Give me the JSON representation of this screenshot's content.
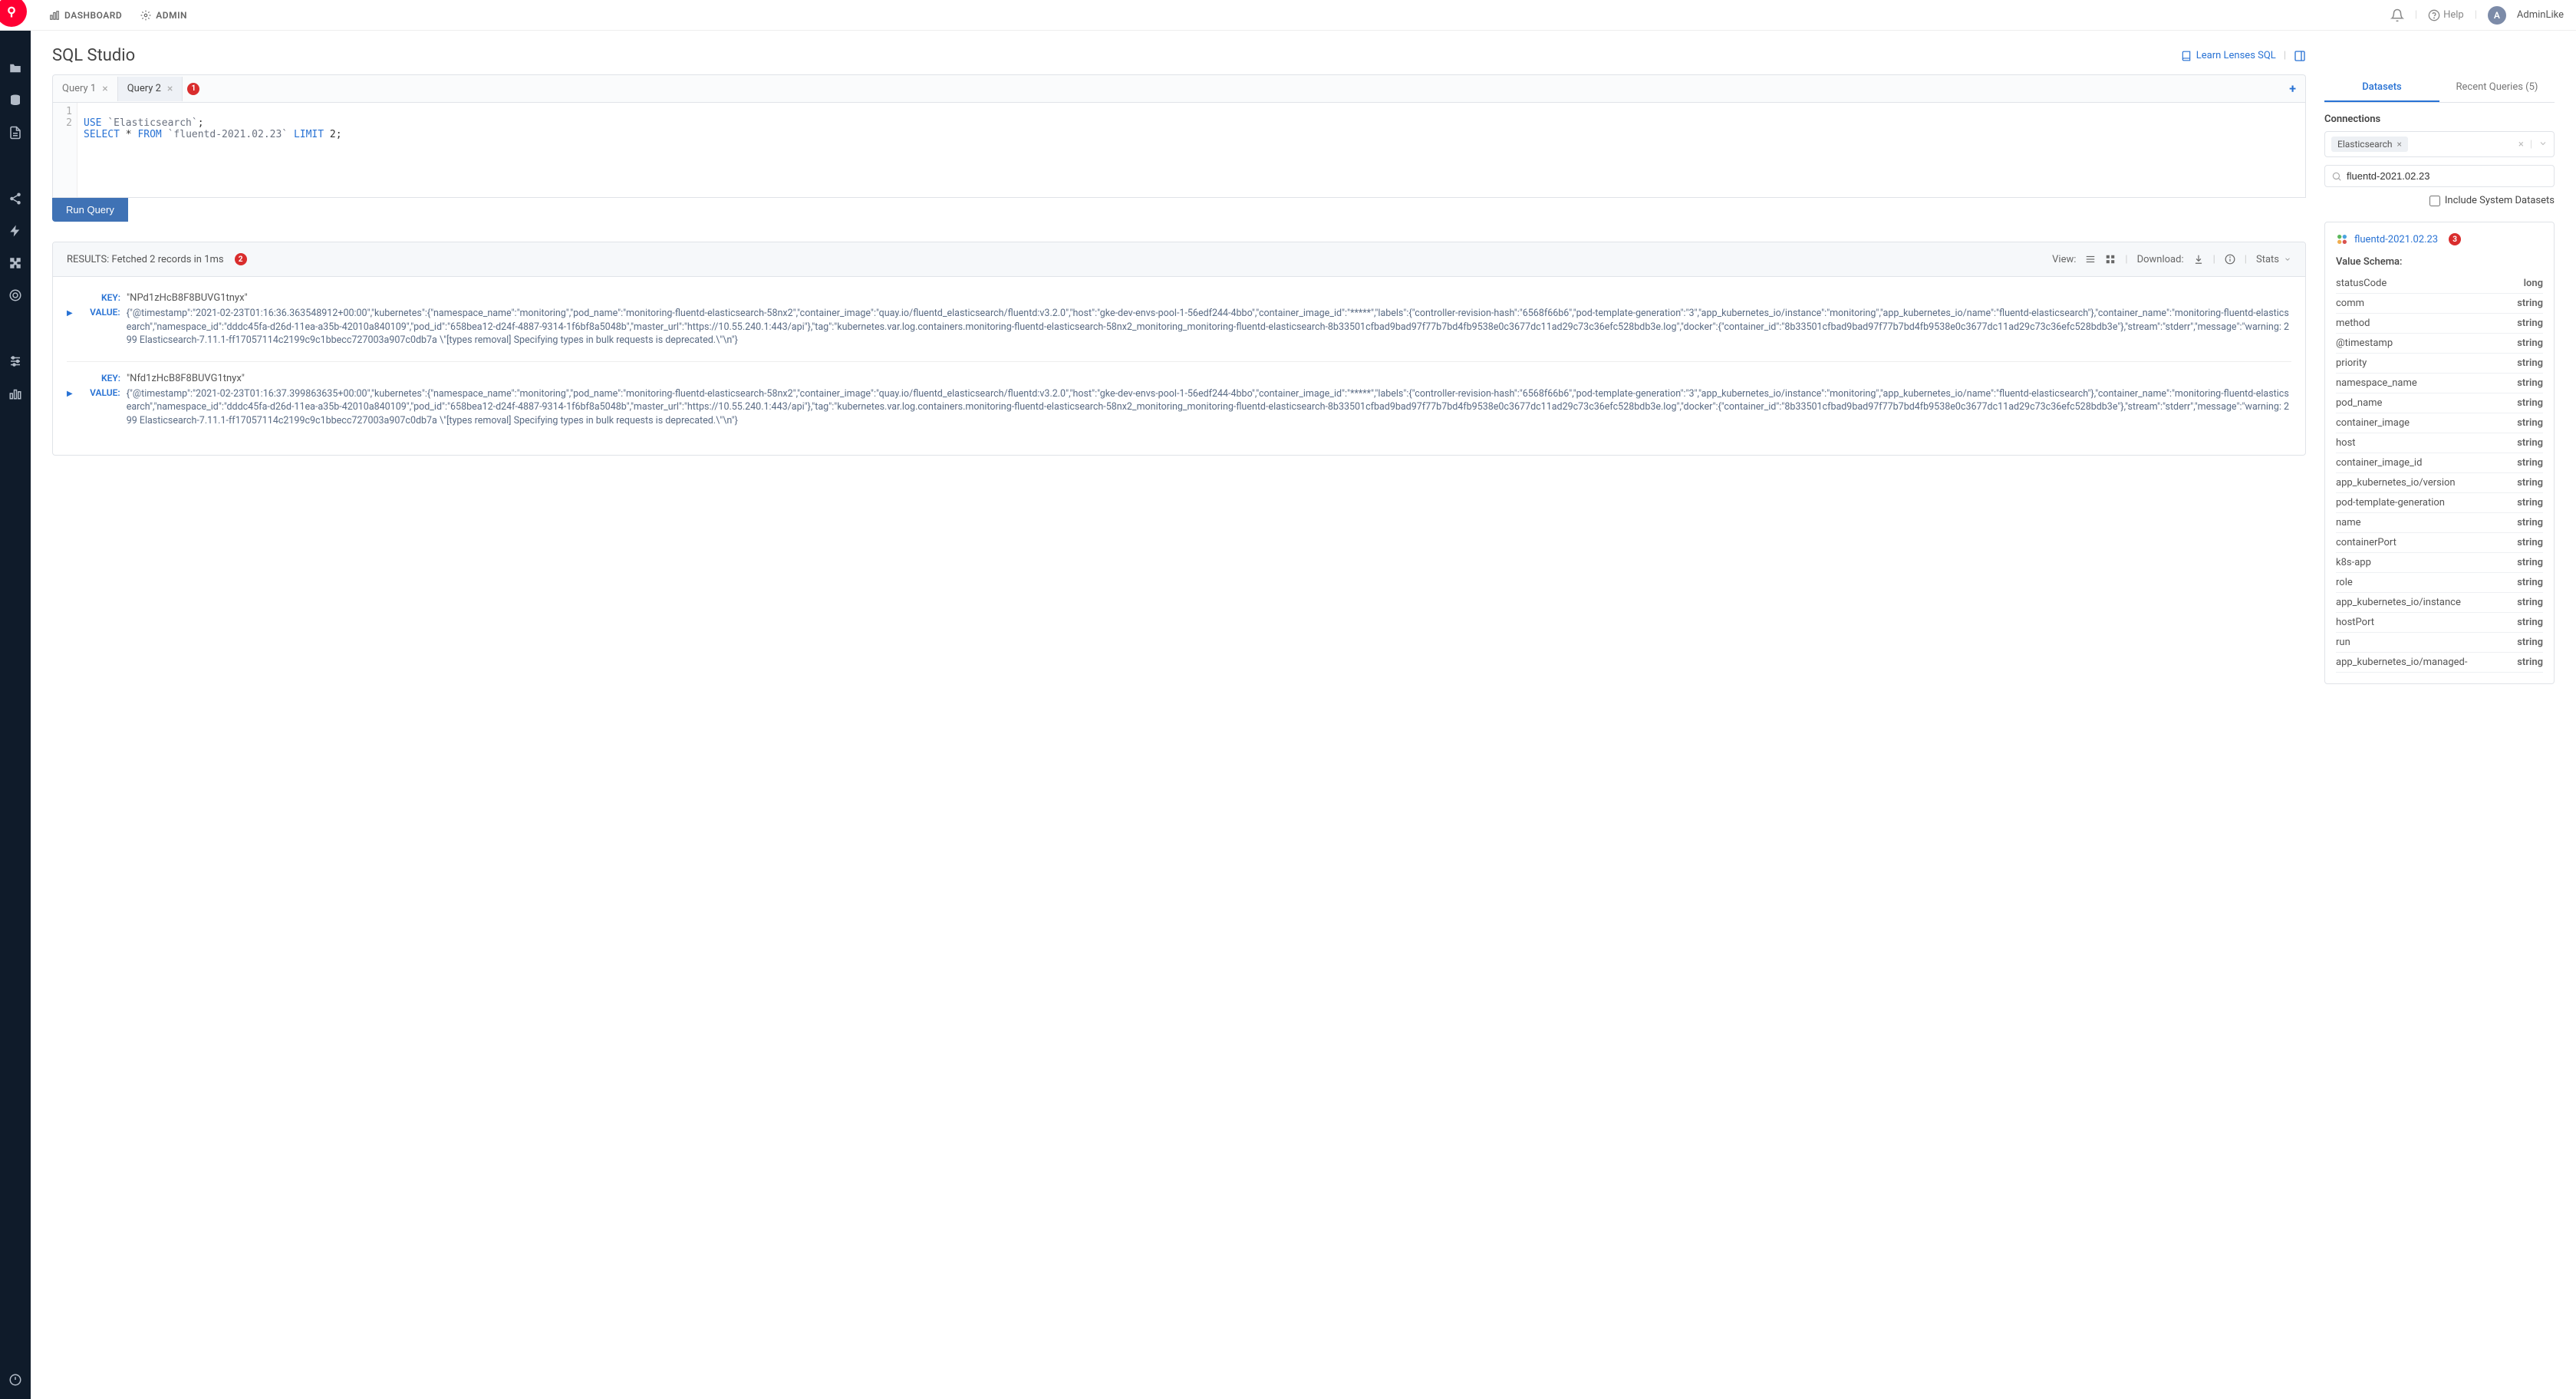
{
  "header": {
    "nav_dashboard": "DASHBOARD",
    "nav_admin": "ADMIN",
    "help": "Help",
    "user_initial": "A",
    "user_name": "AdminLike"
  },
  "page": {
    "title": "SQL Studio",
    "learn_link": "Learn Lenses SQL"
  },
  "tabs": {
    "items": [
      {
        "label": "Query 1",
        "active": false
      },
      {
        "label": "Query 2",
        "active": true
      }
    ],
    "badge": "1"
  },
  "editor": {
    "line1_num": "1",
    "line2_num": "2",
    "kw_use": "USE",
    "str_conn": "`Elasticsearch`",
    "semi1": ";",
    "kw_select": "SELECT",
    "star": " * ",
    "kw_from": "FROM",
    "str_table": " `fluentd-2021.02.23` ",
    "kw_limit": "LIMIT",
    "limit_val": " 2",
    "semi2": ";"
  },
  "run_button": "Run Query",
  "results": {
    "header_text": "RESULTS: Fetched 2 records in 1ms",
    "badge": "2",
    "view_label": "View:",
    "download_label": "Download:",
    "stats_label": "Stats",
    "records": [
      {
        "key_label": "KEY:",
        "key": "\"NPd1zHcB8F8BUVG1tnyx\"",
        "value_label": "VALUE:",
        "value": "{\"@timestamp\":\"2021-02-23T01:16:36.363548912+00:00\",\"kubernetes\":{\"namespace_name\":\"monitoring\",\"pod_name\":\"monitoring-fluentd-elasticsearch-58nx2\",\"container_image\":\"quay.io/fluentd_elasticsearch/fluentd:v3.2.0\",\"host\":\"gke-dev-envs-pool-1-56edf244-4bbo\",\"container_image_id\":\"*****\",\"labels\":{\"controller-revision-hash\":\"6568f66b6\",\"pod-template-generation\":\"3\",\"app_kubernetes_io/instance\":\"monitoring\",\"app_kubernetes_io/name\":\"fluentd-elasticsearch\"},\"container_name\":\"monitoring-fluentd-elasticsearch\",\"namespace_id\":\"dddc45fa-d26d-11ea-a35b-42010a840109\",\"pod_id\":\"658bea12-d24f-4887-9314-1f6bf8a5048b\",\"master_url\":\"https://10.55.240.1:443/api\"},\"tag\":\"kubernetes.var.log.containers.monitoring-fluentd-elasticsearch-58nx2_monitoring_monitoring-fluentd-elasticsearch-8b33501cfbad9bad97f77b7bd4fb9538e0c3677dc11ad29c73c36efc528bdb3e.log\",\"docker\":{\"container_id\":\"8b33501cfbad9bad97f77b7bd4fb9538e0c3677dc11ad29c73c36efc528bdb3e\"},\"stream\":\"stderr\",\"message\":\"warning: 299 Elasticsearch-7.11.1-ff17057114c2199c9c1bbecc727003a907c0db7a \\\"[types removal] Specifying types in bulk requests is deprecated.\\\"\\n\"}"
      },
      {
        "key_label": "KEY:",
        "key": "\"Nfd1zHcB8F8BUVG1tnyx\"",
        "value_label": "VALUE:",
        "value": "{\"@timestamp\":\"2021-02-23T01:16:37.399863635+00:00\",\"kubernetes\":{\"namespace_name\":\"monitoring\",\"pod_name\":\"monitoring-fluentd-elasticsearch-58nx2\",\"container_image\":\"quay.io/fluentd_elasticsearch/fluentd:v3.2.0\",\"host\":\"gke-dev-envs-pool-1-56edf244-4bbo\",\"container_image_id\":\"*****\",\"labels\":{\"controller-revision-hash\":\"6568f66b6\",\"pod-template-generation\":\"3\",\"app_kubernetes_io/instance\":\"monitoring\",\"app_kubernetes_io/name\":\"fluentd-elasticsearch\"},\"container_name\":\"monitoring-fluentd-elasticsearch\",\"namespace_id\":\"dddc45fa-d26d-11ea-a35b-42010a840109\",\"pod_id\":\"658bea12-d24f-4887-9314-1f6bf8a5048b\",\"master_url\":\"https://10.55.240.1:443/api\"},\"tag\":\"kubernetes.var.log.containers.monitoring-fluentd-elasticsearch-58nx2_monitoring_monitoring-fluentd-elasticsearch-8b33501cfbad9bad97f77b7bd4fb9538e0c3677dc11ad29c73c36efc528bdb3e.log\",\"docker\":{\"container_id\":\"8b33501cfbad9bad97f77b7bd4fb9538e0c3677dc11ad29c73c36efc528bdb3e\"},\"stream\":\"stderr\",\"message\":\"warning: 299 Elasticsearch-7.11.1-ff17057114c2199c9c1bbecc727003a907c0db7a \\\"[types removal] Specifying types in bulk requests is deprecated.\\\"\\n\"}"
      }
    ]
  },
  "side": {
    "tab_datasets": "Datasets",
    "tab_recent": "Recent Queries (5)",
    "connections_label": "Connections",
    "connection_chip": "Elasticsearch",
    "search_value": "fluentd-2021.02.23",
    "include_system": "Include System Datasets",
    "dataset_name": "fluentd-2021.02.23",
    "dataset_badge": "3",
    "schema_label": "Value Schema:",
    "schema": [
      {
        "field": "statusCode",
        "type": "long"
      },
      {
        "field": "comm",
        "type": "string"
      },
      {
        "field": "method",
        "type": "string"
      },
      {
        "field": "@timestamp",
        "type": "string"
      },
      {
        "field": "priority",
        "type": "string"
      },
      {
        "field": "namespace_name",
        "type": "string"
      },
      {
        "field": "pod_name",
        "type": "string"
      },
      {
        "field": "container_image",
        "type": "string"
      },
      {
        "field": "host",
        "type": "string"
      },
      {
        "field": "container_image_id",
        "type": "string"
      },
      {
        "field": "app_kubernetes_io/version",
        "type": "string"
      },
      {
        "field": "pod-template-generation",
        "type": "string"
      },
      {
        "field": "name",
        "type": "string"
      },
      {
        "field": "containerPort",
        "type": "string"
      },
      {
        "field": "k8s-app",
        "type": "string"
      },
      {
        "field": "role",
        "type": "string"
      },
      {
        "field": "app_kubernetes_io/instance",
        "type": "string"
      },
      {
        "field": "hostPort",
        "type": "string"
      },
      {
        "field": "run",
        "type": "string"
      },
      {
        "field": "app_kubernetes_io/managed-",
        "type": "string"
      }
    ]
  }
}
